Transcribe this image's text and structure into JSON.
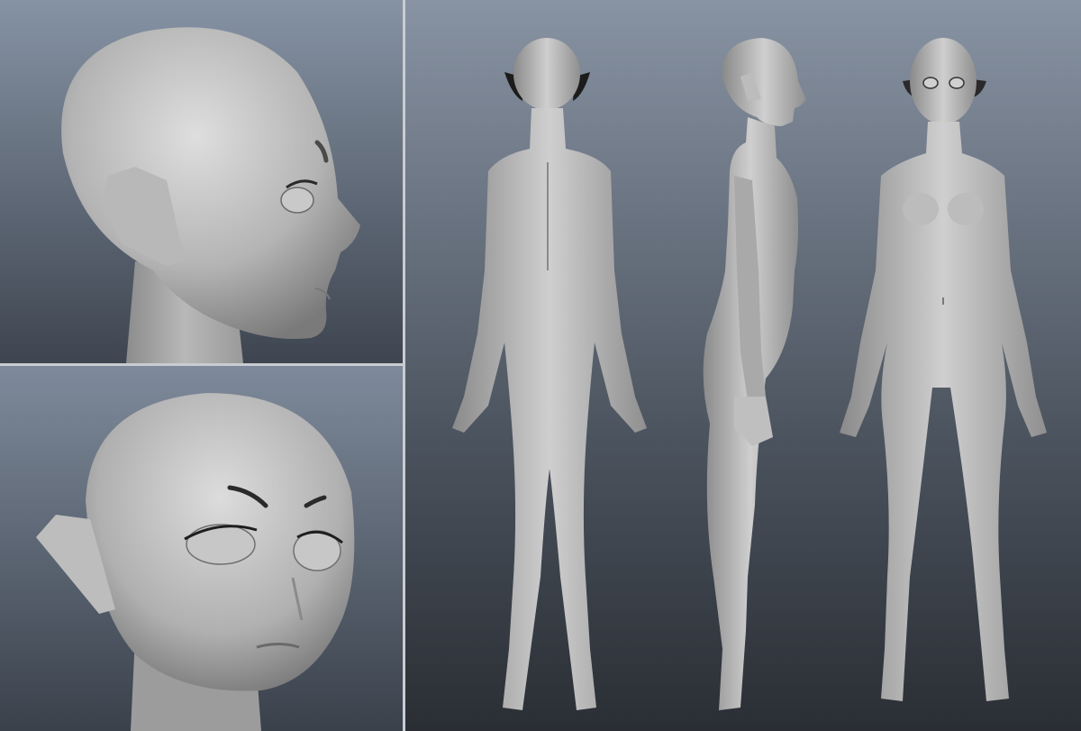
{
  "viewports": [
    {
      "view": "head-side",
      "subject": "3d-head-profile"
    },
    {
      "view": "head-front-three-quarter",
      "subject": "3d-head-front"
    },
    {
      "view": "full-body-turnaround",
      "subject": "3d-body-back-side-front"
    }
  ],
  "colors": {
    "viewport_top": "#8a95a5",
    "viewport_bottom": "#2e333a",
    "model_light": "#d9d9d9",
    "model_mid": "#a8a8a8",
    "model_shadow": "#6e6e6e",
    "ear_plane": "#b9b9b9",
    "divider": "#c9ccd1"
  }
}
